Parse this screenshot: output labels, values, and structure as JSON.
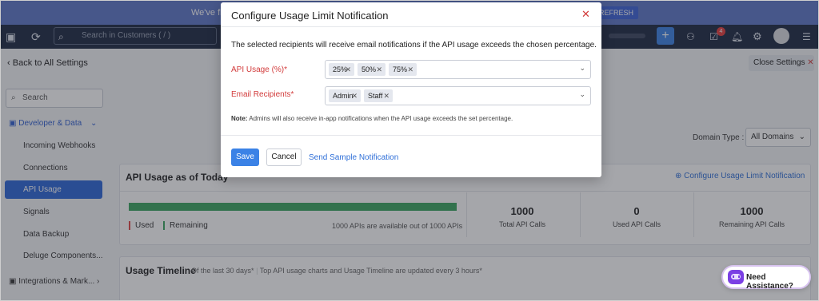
{
  "banner": {
    "text": "We've fi",
    "refresh": "REFRESH"
  },
  "header": {
    "search_placeholder": "Search in Customers ( / )",
    "notification_badge": "4"
  },
  "settings": {
    "back_label": "Back to All Settings",
    "close_label": "Close Settings"
  },
  "sidebar": {
    "search_label": "Search",
    "group_label": "Developer & Data",
    "items": [
      "Incoming Webhooks",
      "Connections",
      "API Usage",
      "Signals",
      "Data Backup",
      "Deluge Components..."
    ],
    "group2_label": "Integrations & Mark..."
  },
  "domain": {
    "label": "Domain Type :",
    "value": "All Domains"
  },
  "usage_card": {
    "title": "API Usage as of Today",
    "configure_link": "Configure Usage Limit Notification",
    "legend_used": "Used",
    "legend_remaining": "Remaining",
    "available_text": "1000 APIs are available out of 1000 APIs",
    "remaining_fraction": 1.0,
    "stats": [
      {
        "value": "1000",
        "label": "Total API Calls"
      },
      {
        "value": "0",
        "label": "Used API Calls"
      },
      {
        "value": "1000",
        "label": "Remaining API Calls"
      }
    ]
  },
  "timeline": {
    "title": "Usage Timeline",
    "subtitle": "Of the last 30 days*",
    "note": "Top API usage charts and Usage Timeline are updated every 3 hours*"
  },
  "modal": {
    "title": "Configure Usage Limit Notification",
    "close_glyph": "✕",
    "description": "The selected recipients will receive email notifications if the API usage exceeds the chosen percentage.",
    "api_usage_label": "API Usage (%)*",
    "api_usage_chips": [
      "25%",
      "50%",
      "75%"
    ],
    "email_label": "Email Recipients*",
    "email_chips": [
      "Admin",
      "Staff"
    ],
    "note_prefix": "Note:",
    "note_text": "Admins will also receive in-app notifications when the API usage exceeds the set percentage.",
    "save": "Save",
    "cancel": "Cancel",
    "sample_link": "Send Sample Notification"
  },
  "assist": {
    "label": "Need Assistance?"
  },
  "colors": {
    "accent": "#3b82e6",
    "header_bg": "#1d2943",
    "bar_green": "#3aa55f",
    "required_red": "#d23b3b"
  }
}
